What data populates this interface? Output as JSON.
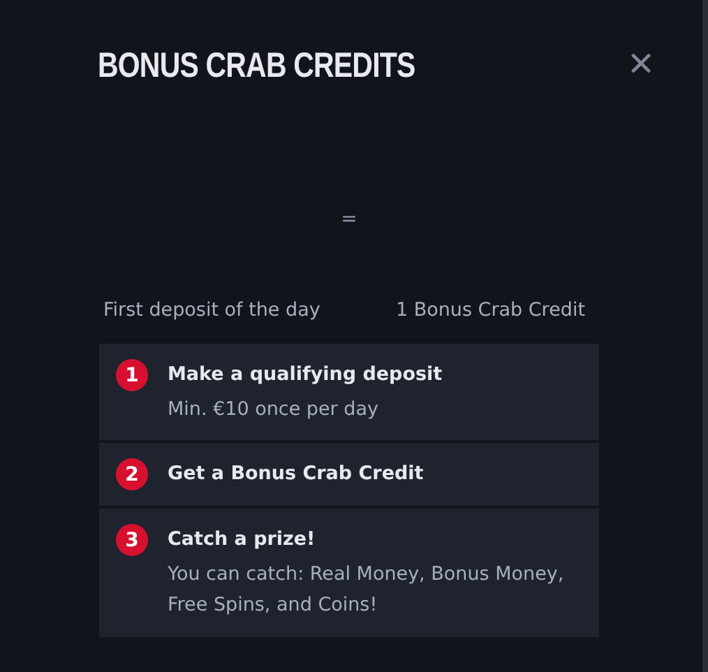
{
  "modal": {
    "title": "BONUS CRAB CREDITS",
    "close": "✕"
  },
  "equation": {
    "symbol": "=",
    "left": "First deposit of the day",
    "right": "1 Bonus Crab Credit"
  },
  "steps": [
    {
      "number": "1",
      "title": "Make a qualifying deposit",
      "detail": "Min. €10 once per day"
    },
    {
      "number": "2",
      "title": "Get a Bonus Crab Credit"
    },
    {
      "number": "3",
      "title": "Catch a prize!",
      "detail": "You can catch: Real Money, Bonus Money, Free Spins, and Coins!"
    }
  ]
}
